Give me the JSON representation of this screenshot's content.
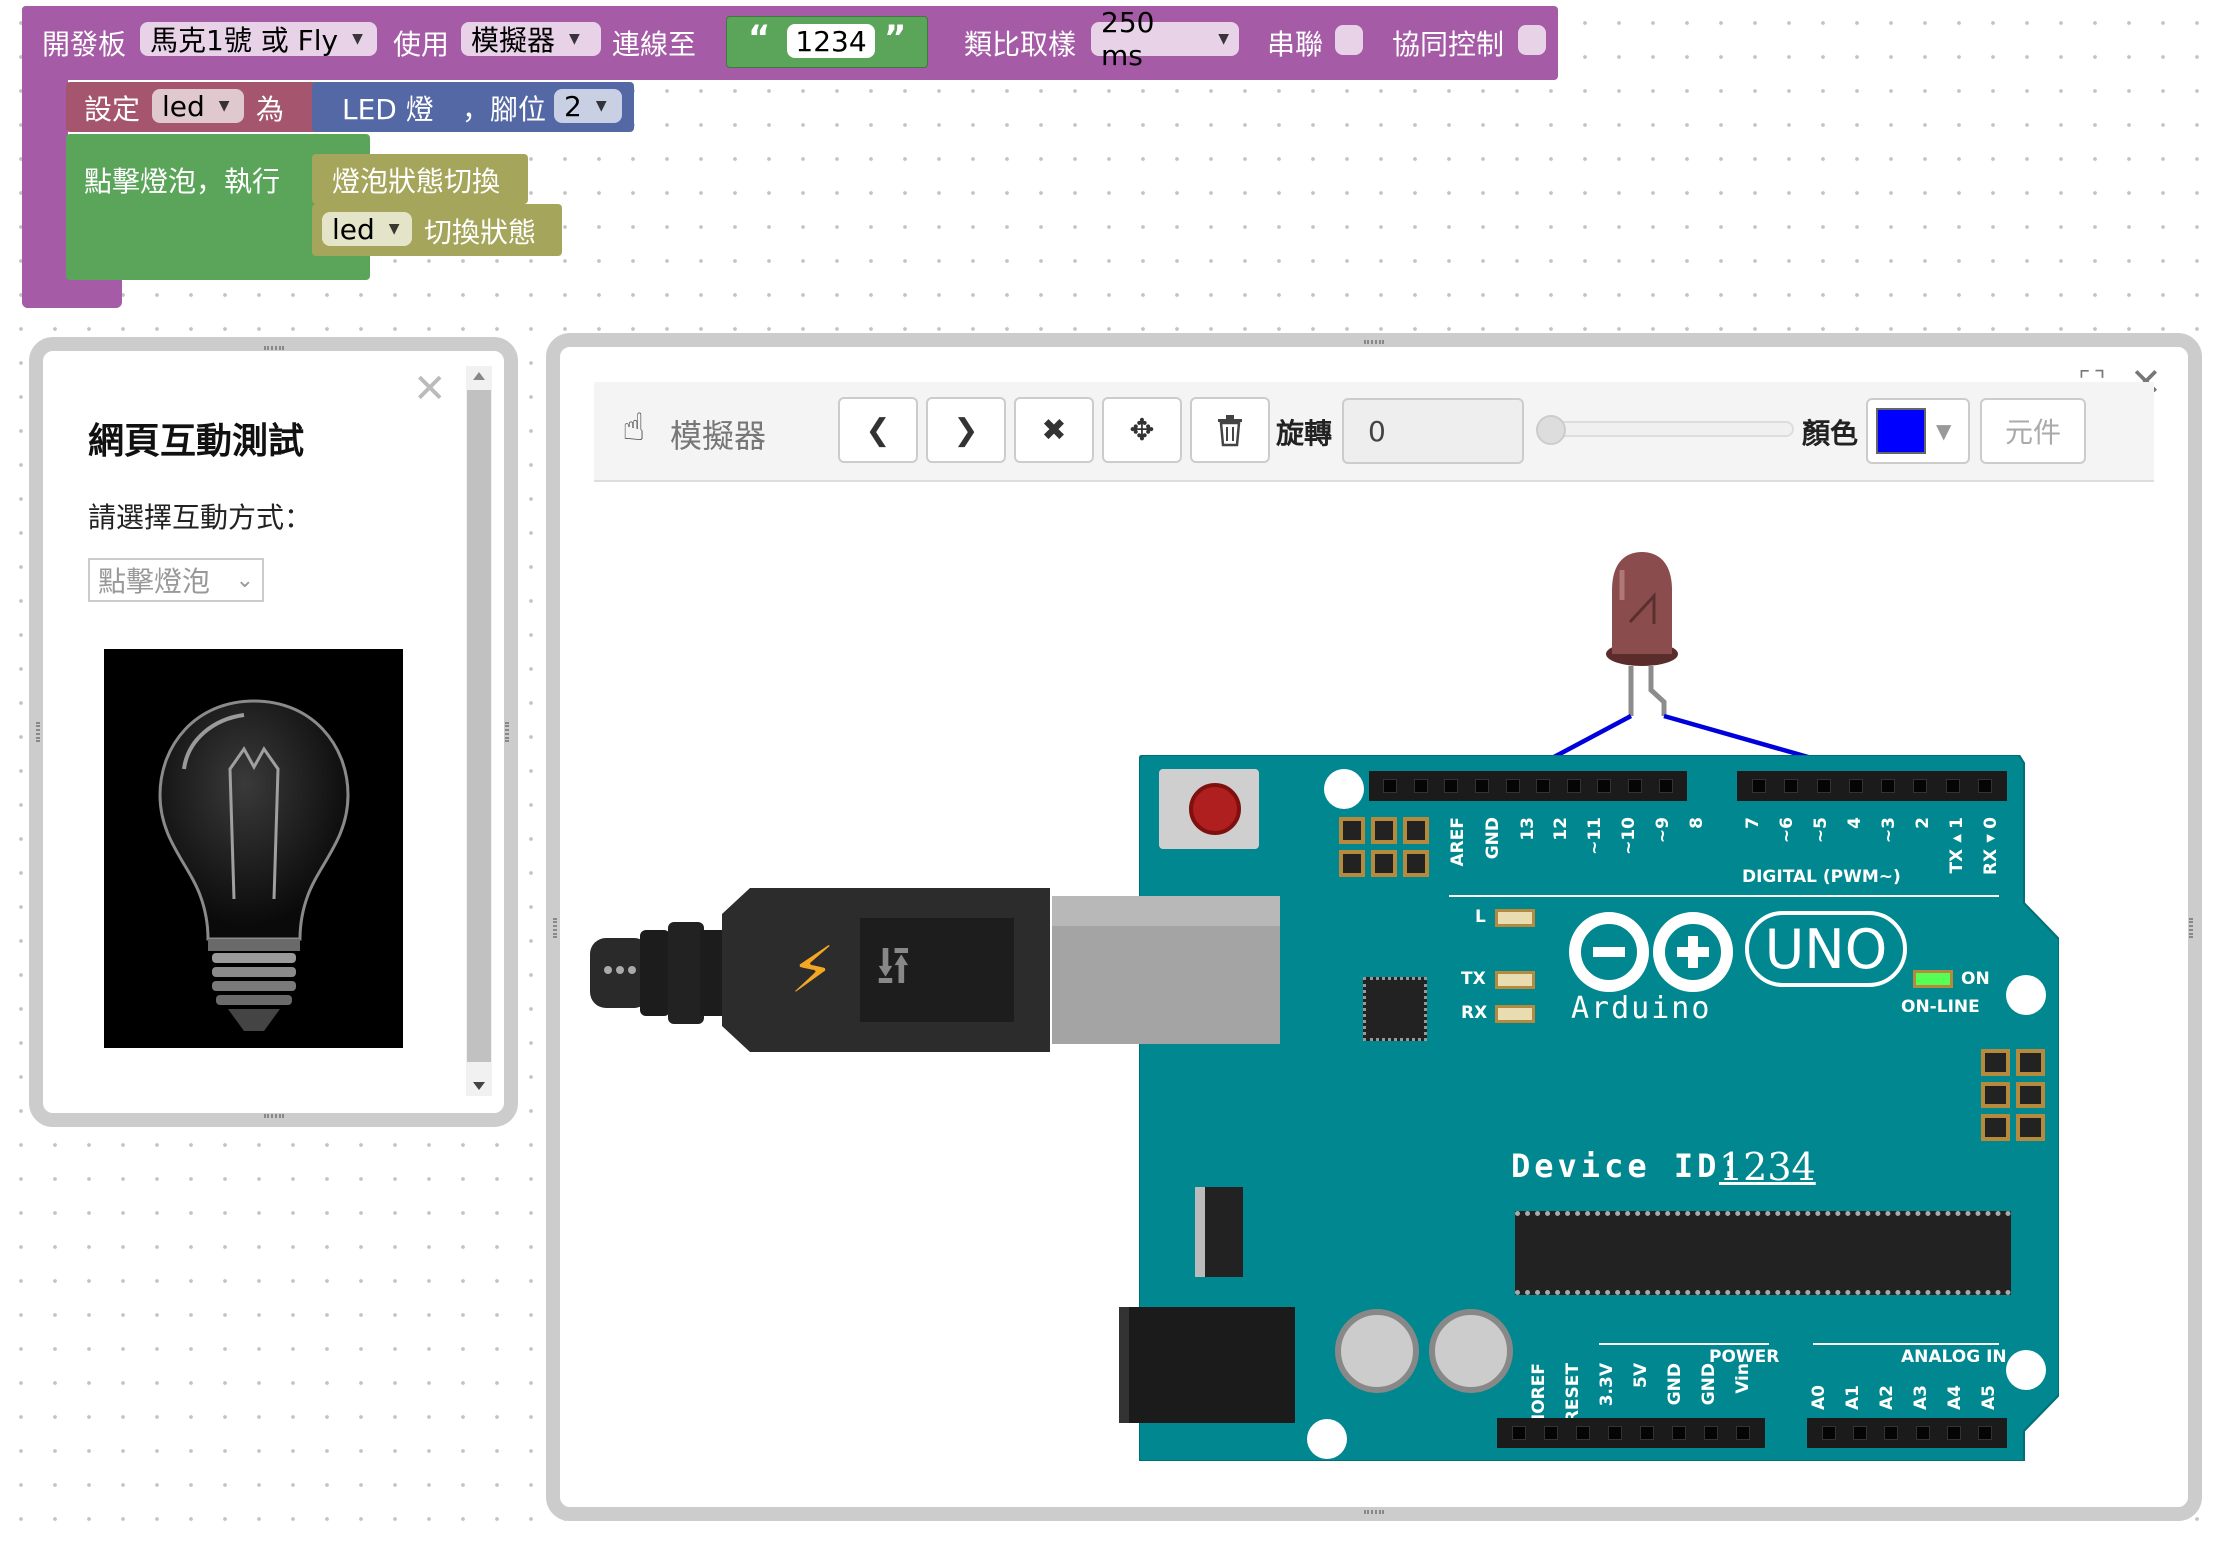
{
  "blocks": {
    "header": {
      "board_label": "開發板",
      "board_value": "馬克1號 或 Fly",
      "use_label": "使用",
      "use_value": "模擬器",
      "connect_label": "連線至",
      "device_id": "1234",
      "sample_label": "類比取樣",
      "sample_value": "250 ms",
      "serial_label": "串聯",
      "coop_label": "協同控制"
    },
    "set": {
      "set_label": "設定",
      "var": "led",
      "as_label": "為",
      "led_label": "LED 燈",
      "pin_label": "，腳位",
      "pin_value": "2"
    },
    "event": {
      "label": "點擊燈泡，執行"
    },
    "toggle": {
      "label": "燈泡狀態切換",
      "var": "led",
      "action": "切換狀態"
    }
  },
  "web_panel": {
    "title": "網頁互動測試",
    "prompt": "請選擇互動方式：",
    "select_value": "點擊燈泡"
  },
  "simulator": {
    "title": "模擬器",
    "rotate_label": "旋轉",
    "rotate_value": "0",
    "rotate_fraction": 0,
    "color_label": "顏色",
    "color_value": "#0000ff",
    "component_button": "元件"
  },
  "board": {
    "brand_name": "Arduino",
    "model": "UNO",
    "device_id_label": "Device ID:",
    "device_id": "1234",
    "digital_header": "DIGITAL (PWM~)",
    "on_label": "ON",
    "online_label": "ON-LINE",
    "l_label": "L",
    "tx_label": "TX",
    "rx_label": "RX",
    "power_header": "POWER",
    "analog_header": "ANALOG IN",
    "top_pins_left": [
      "AREF",
      "GND",
      "13",
      "12",
      "~11",
      "~10",
      "~9",
      "8"
    ],
    "top_pins_right": [
      "7",
      "~6",
      "~5",
      "4",
      "~3",
      "2",
      "TX▸1",
      "RX◂0"
    ],
    "power_pins": [
      "IOREF",
      "RESET",
      "3.3V",
      "5V",
      "GND",
      "GND",
      "Vin"
    ],
    "analog_pins": [
      "A0",
      "A1",
      "A2",
      "A3",
      "A4",
      "A5"
    ]
  },
  "colors": {
    "block_purple": "#a55ba6",
    "block_pink": "#a5566e",
    "block_blue": "#5468a5",
    "block_green": "#5ba55b",
    "block_olive": "#a5a55b",
    "board_teal": "#00878f",
    "wire": "#0000dd"
  }
}
